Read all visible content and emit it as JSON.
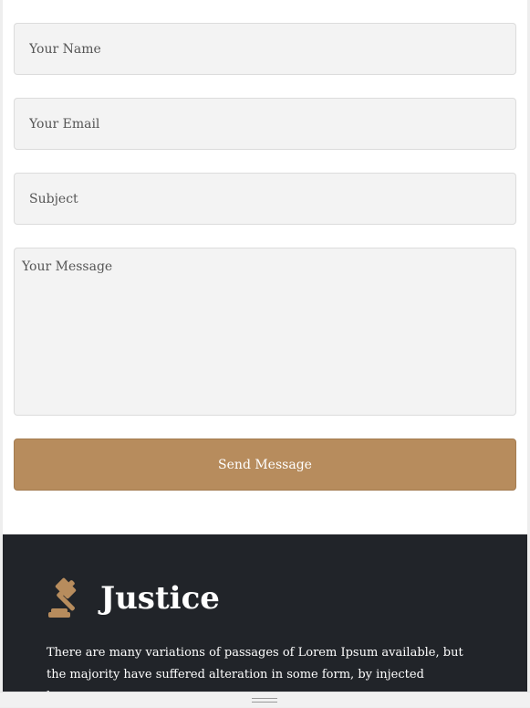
{
  "contact_form": {
    "name_placeholder": "Your Name",
    "email_placeholder": "Your Email",
    "subject_placeholder": "Subject",
    "message_placeholder": "Your Message",
    "send_label": "Send Message"
  },
  "footer": {
    "brand_icon": "gavel-icon",
    "brand_name": "Justice",
    "description": "There are many variations of passages of Lorem Ipsum available, but the majority have suffered alteration in some form, by injected humour."
  },
  "colors": {
    "accent": "#b78c5d",
    "footer_bg": "#212429",
    "field_bg": "#f3f3f3"
  }
}
